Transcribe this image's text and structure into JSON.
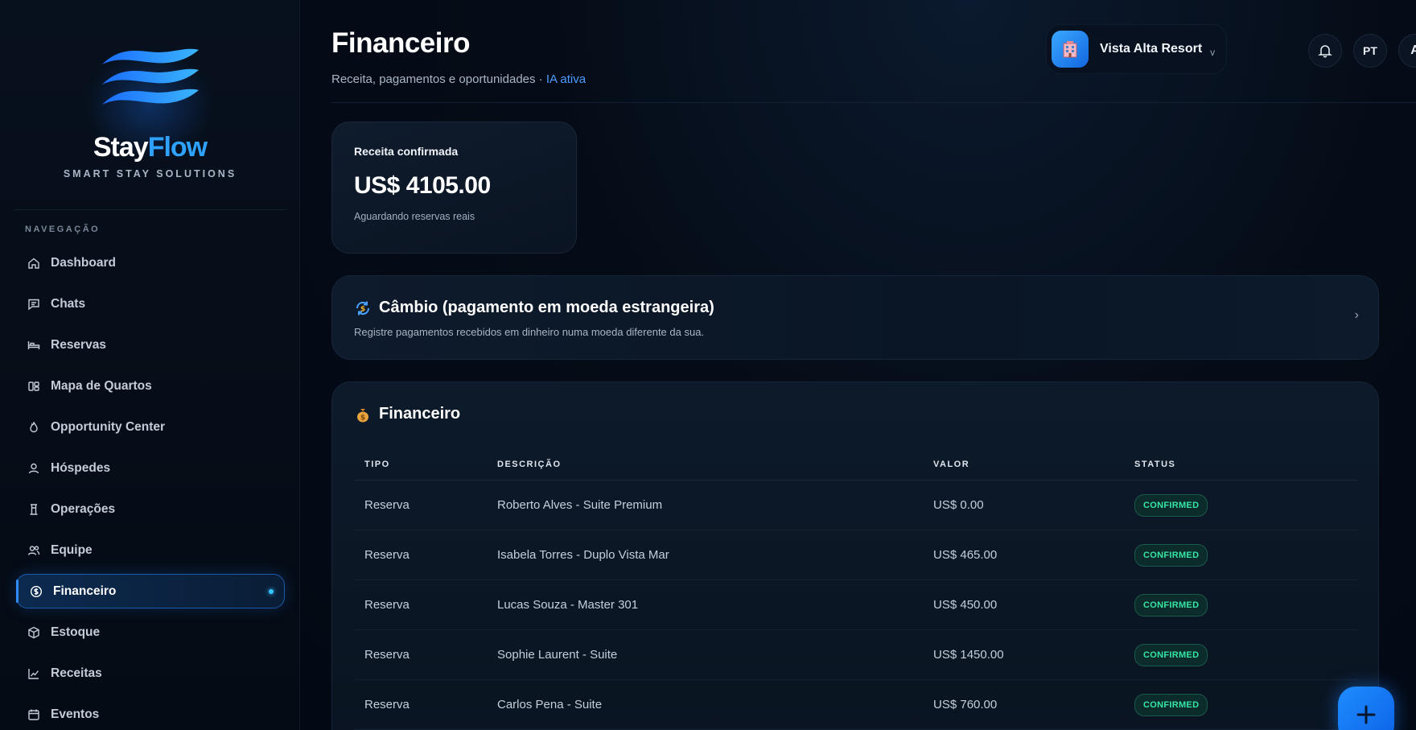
{
  "brand": {
    "name_part1": "Stay",
    "name_part2": "Flow",
    "tagline": "SMART STAY SOLUTIONS"
  },
  "sidebar": {
    "section_label": "NAVEGAÇÃO",
    "items": [
      {
        "label": "Dashboard",
        "icon": "home-icon",
        "active": false
      },
      {
        "label": "Chats",
        "icon": "chat-icon",
        "active": false
      },
      {
        "label": "Reservas",
        "icon": "bed-icon",
        "active": false
      },
      {
        "label": "Mapa de Quartos",
        "icon": "layout-icon",
        "active": false
      },
      {
        "label": "Opportunity Center",
        "icon": "flame-icon",
        "active": false
      },
      {
        "label": "Hóspedes",
        "icon": "user-icon",
        "active": false
      },
      {
        "label": "Operações",
        "icon": "tower-icon",
        "active": false
      },
      {
        "label": "Equipe",
        "icon": "users-icon",
        "active": false
      },
      {
        "label": "Financeiro",
        "icon": "dollar-icon",
        "active": true
      },
      {
        "label": "Estoque",
        "icon": "box-icon",
        "active": false
      },
      {
        "label": "Receitas",
        "icon": "chart-line-icon",
        "active": false
      },
      {
        "label": "Eventos",
        "icon": "calendar-icon",
        "active": false
      }
    ]
  },
  "header": {
    "title": "Financeiro",
    "subtitle": "Receita, pagamentos e oportunidades · ",
    "ai_status": "IA ativa",
    "hotel_name": "Vista Alta Resort",
    "hotel_chevron": "v",
    "language": "PT",
    "avatar_initial": "A"
  },
  "revenue_card": {
    "label": "Receita confirmada",
    "value": "US$ 4105.00",
    "note": "Aguardando reservas reais"
  },
  "cambio_card": {
    "title": "Câmbio (pagamento em moeda estrangeira)",
    "subtitle": "Registre pagamentos recebidos em dinheiro numa moeda diferente da sua.",
    "chevron": "›"
  },
  "finance_table": {
    "title": "Financeiro",
    "columns": [
      "TIPO",
      "DESCRIÇÃO",
      "VALOR",
      "STATUS"
    ],
    "rows": [
      {
        "tipo": "Reserva",
        "descricao": "Roberto Alves - Suite Premium",
        "valor": "US$ 0.00",
        "status": "CONFIRMED"
      },
      {
        "tipo": "Reserva",
        "descricao": "Isabela Torres - Duplo Vista Mar",
        "valor": "US$ 465.00",
        "status": "CONFIRMED"
      },
      {
        "tipo": "Reserva",
        "descricao": "Lucas Souza - Master 301",
        "valor": "US$ 450.00",
        "status": "CONFIRMED"
      },
      {
        "tipo": "Reserva",
        "descricao": "Sophie Laurent - Suite",
        "valor": "US$ 1450.00",
        "status": "CONFIRMED"
      },
      {
        "tipo": "Reserva",
        "descricao": "Carlos Pena - Suite",
        "valor": "US$ 760.00",
        "status": "CONFIRMED"
      }
    ]
  },
  "colors": {
    "accent": "#2fa2ff",
    "status_confirmed": "#37e6a4",
    "background": "#030914"
  }
}
